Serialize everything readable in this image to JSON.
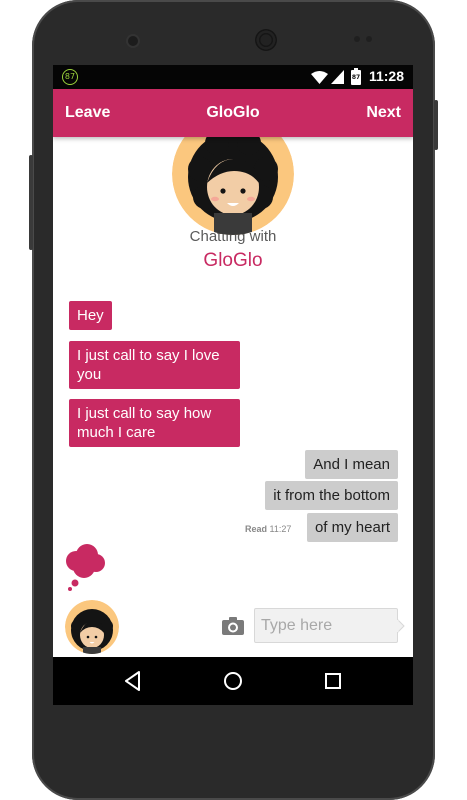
{
  "status_bar": {
    "notification_badge": "87",
    "calendar_day": "87",
    "time": "11:28",
    "icons": [
      "notification-counter-icon",
      "wifi-icon",
      "signal-icon",
      "battery-icon"
    ]
  },
  "app_bar": {
    "leave_label": "Leave",
    "title": "GloGlo",
    "next_label": "Next",
    "background_color": "#c82a62"
  },
  "profile": {
    "chatting_with": "Chatting with",
    "name": "GloGlo"
  },
  "messages": [
    {
      "direction": "incoming",
      "text": "Hey"
    },
    {
      "direction": "incoming",
      "text": "I just call to say I love you"
    },
    {
      "direction": "incoming",
      "text": "I just call to say how much I care"
    },
    {
      "direction": "outgoing",
      "text": "And I mean"
    },
    {
      "direction": "outgoing",
      "text": "it from the bottom"
    },
    {
      "direction": "outgoing",
      "text": "of my heart"
    }
  ],
  "read_receipt": {
    "label": "Read",
    "time": "11:27"
  },
  "composer": {
    "placeholder": "Type here",
    "value": ""
  },
  "colors": {
    "accent": "#c82a62",
    "incoming_bubble": "#c82a62",
    "outgoing_bubble": "#cccccc"
  },
  "nav_bar": {
    "buttons": [
      "back-icon",
      "home-icon",
      "recents-icon"
    ]
  }
}
